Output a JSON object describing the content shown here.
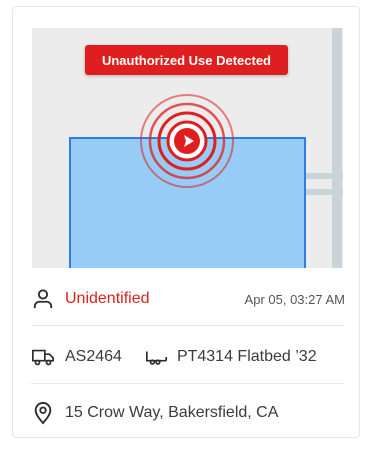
{
  "alert": {
    "label": "Unauthorized Use Detected",
    "color": "#df1f1f"
  },
  "driver": {
    "name": "Unidentified",
    "timestamp": "Apr 05, 03:27 AM",
    "icon": "person-icon"
  },
  "vehicle": {
    "id": "AS2464",
    "icon": "truck-icon"
  },
  "trailer": {
    "label": "PT4314 Flatbed ’32",
    "icon": "trailer-icon"
  },
  "location": {
    "address": "15 Crow Way, Bakersfield, CA",
    "icon": "location-pin-icon"
  },
  "map": {
    "geofence_fill": "#96ccf6",
    "geofence_stroke": "#2c7ee6",
    "marker_color": "#df1f1f"
  }
}
